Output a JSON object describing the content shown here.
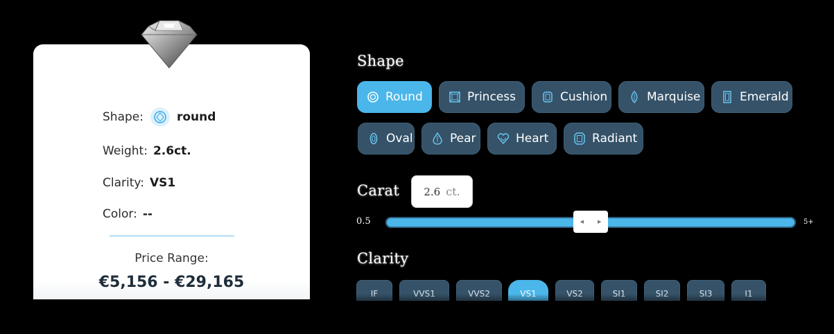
{
  "summary": {
    "shape_label": "Shape:",
    "shape_value": "round",
    "weight_label": "Weight:",
    "weight_value": "2.6ct.",
    "clarity_label": "Clarity:",
    "clarity_value": "VS1",
    "color_label": "Color:",
    "color_value": "--",
    "price_label": "Price Range:",
    "price_value": "€5,156 - €29,165"
  },
  "shape_filter": {
    "heading": "Shape",
    "options": [
      {
        "label": "Round",
        "icon": "round-icon",
        "active": true
      },
      {
        "label": "Princess",
        "icon": "princess-icon",
        "active": false
      },
      {
        "label": "Cushion",
        "icon": "cushion-icon",
        "active": false
      },
      {
        "label": "Marquise",
        "icon": "marquise-icon",
        "active": false
      },
      {
        "label": "Emerald",
        "icon": "emerald-icon",
        "active": false
      },
      {
        "label": "Oval",
        "icon": "oval-icon",
        "active": false
      },
      {
        "label": "Pear",
        "icon": "pear-icon",
        "active": false
      },
      {
        "label": "Heart",
        "icon": "heart-icon",
        "active": false
      },
      {
        "label": "Radiant",
        "icon": "radiant-icon",
        "active": false
      }
    ]
  },
  "carat_filter": {
    "heading": "Carat",
    "value": "2.6",
    "unit": "ct.",
    "min": "0.5",
    "max": "5+",
    "slider_fraction": 0.5
  },
  "clarity_filter": {
    "heading": "Clarity",
    "options": [
      {
        "label": "IF",
        "active": false
      },
      {
        "label": "VVS1",
        "active": false
      },
      {
        "label": "VVS2",
        "active": false
      },
      {
        "label": "VS1",
        "active": true
      },
      {
        "label": "VS2",
        "active": false
      },
      {
        "label": "SI1",
        "active": false
      },
      {
        "label": "SI2",
        "active": false
      },
      {
        "label": "SI3",
        "active": false
      },
      {
        "label": "I1",
        "active": false
      }
    ]
  },
  "colors": {
    "accent": "#4bb6ea",
    "chip": "#355268",
    "card": "#ffffff"
  }
}
